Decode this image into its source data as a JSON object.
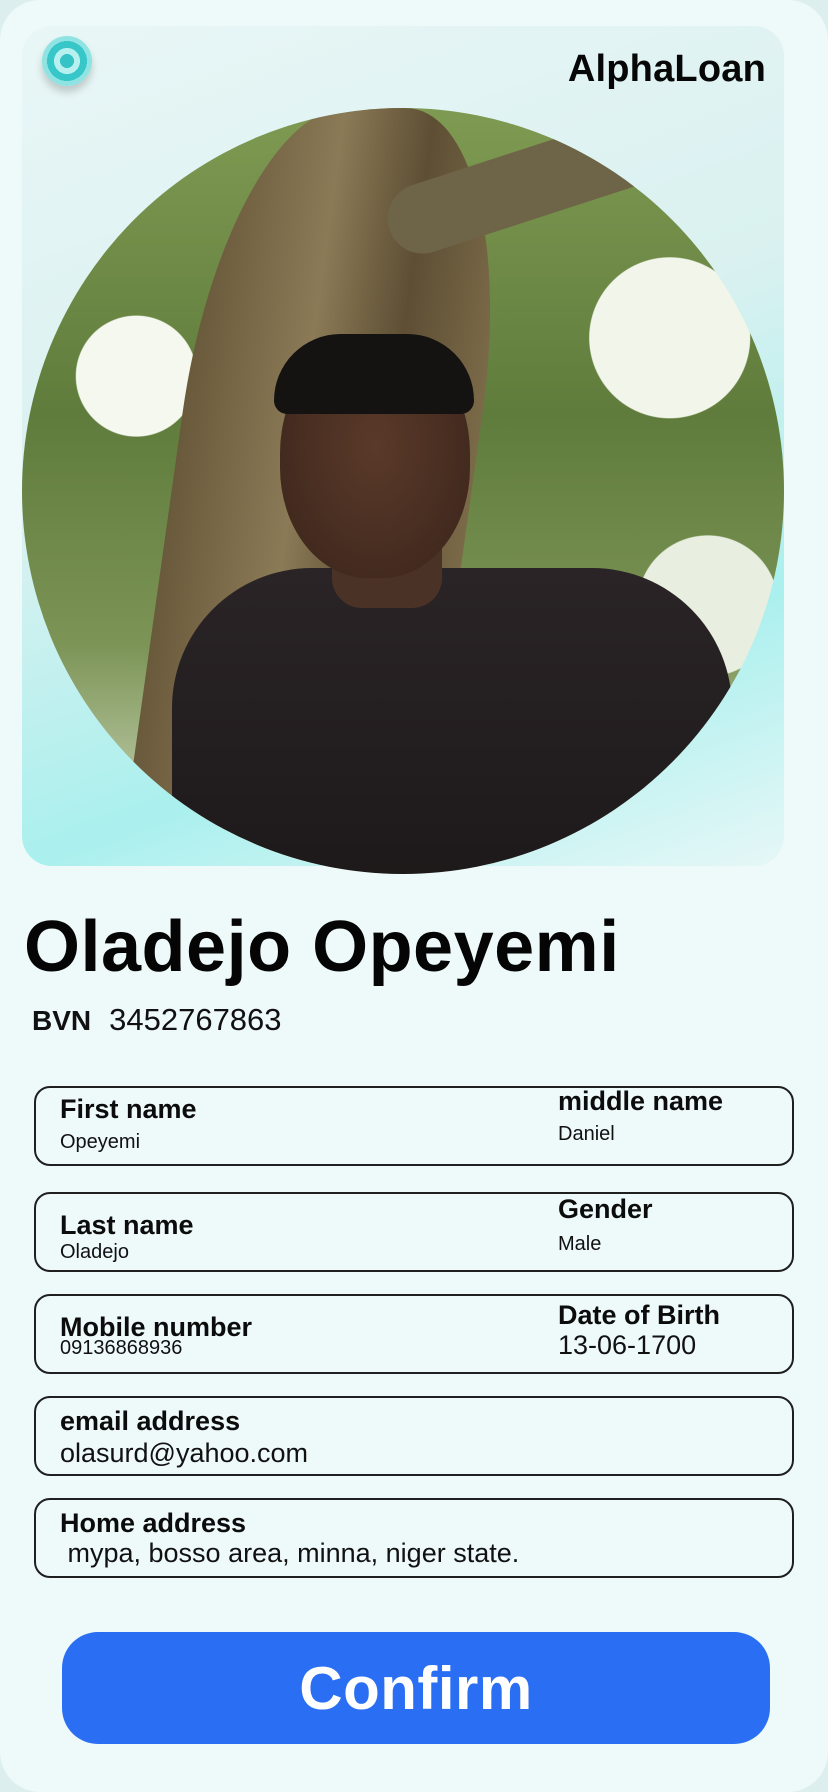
{
  "app": {
    "brand": "AlphaLoan",
    "accent": "#2a6ef3",
    "logo_icon": "target-logo-icon"
  },
  "profile": {
    "full_name": "Oladejo Opeyemi",
    "bvn_label": "BVN",
    "bvn_value": "3452767863",
    "photo": "profile-photo"
  },
  "fields": {
    "first_name": {
      "label": "First name",
      "value": "Opeyemi"
    },
    "middle_name": {
      "label": "middle name",
      "value": "Daniel"
    },
    "last_name": {
      "label": "Last name",
      "value": "Oladejo"
    },
    "gender": {
      "label": "Gender",
      "value": "Male"
    },
    "mobile": {
      "label": "Mobile number",
      "value": "09136868936"
    },
    "dob": {
      "label": "Date of Birth",
      "value": "13-06-1700"
    },
    "email": {
      "label": "email address",
      "value": "olasurd@yahoo.com"
    },
    "address": {
      "label": "Home address",
      "value": " mypa, bosso area, minna, niger state."
    }
  },
  "actions": {
    "confirm_label": "Confirm"
  }
}
